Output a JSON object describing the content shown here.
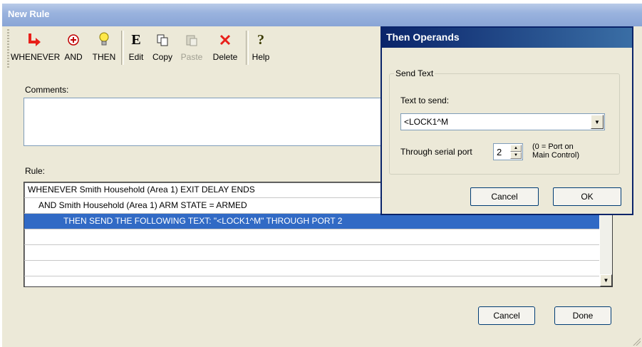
{
  "window": {
    "title": "New Rule"
  },
  "toolbar": {
    "whenever": "WHENEVER",
    "and": "AND",
    "then": "THEN",
    "edit": "Edit",
    "copy": "Copy",
    "paste": "Paste",
    "delete": "Delete",
    "help": "Help"
  },
  "comments": {
    "label": "Comments:",
    "value": ""
  },
  "rule": {
    "label": "Rule:",
    "rows": [
      "WHENEVER  Smith Household (Area 1) EXIT DELAY ENDS",
      "AND Smith Household (Area 1) ARM STATE = ARMED",
      "THEN SEND THE FOLLOWING TEXT: \"<LOCK1^M\" THROUGH PORT 2",
      "",
      "",
      ""
    ]
  },
  "buttons": {
    "cancel": "Cancel",
    "done": "Done"
  },
  "dialog": {
    "title": "Then Operands",
    "group": "Send Text",
    "text_label": "Text to send:",
    "text_value": "<LOCK1^M",
    "port_label": "Through serial port",
    "port_value": "2",
    "port_note_1": "(0 = Port on",
    "port_note_2": "Main Control)",
    "cancel": "Cancel",
    "ok": "OK"
  }
}
